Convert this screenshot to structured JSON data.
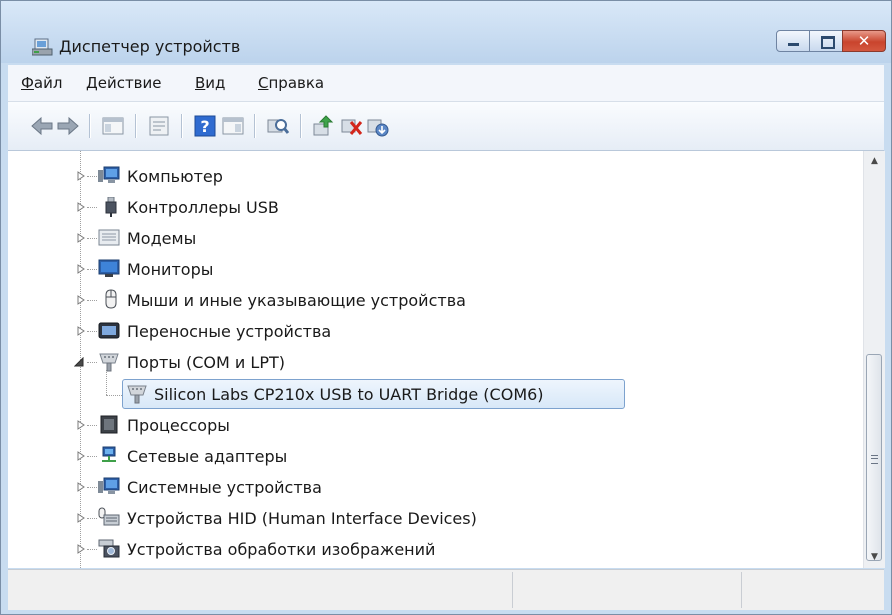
{
  "window": {
    "title": "Диспетчер устройств",
    "caption_buttons": {
      "minimize_icon": "minimize-icon",
      "maximize_icon": "maximize-icon",
      "close_icon": "close-icon",
      "close_glyph": "✕"
    }
  },
  "menu": {
    "items": [
      {
        "accel": "Ф",
        "rest": "айл"
      },
      {
        "accel": "Д",
        "rest": "ействие"
      },
      {
        "accel": "В",
        "rest": "ид"
      },
      {
        "accel": "С",
        "rest": "правка"
      }
    ]
  },
  "toolbar": {
    "icons": [
      "back-icon",
      "forward-icon",
      "show-hide-console-tree-icon",
      "properties-icon",
      "help-icon",
      "action-pane-icon",
      "scan-hardware-icon",
      "update-driver-icon",
      "uninstall-icon",
      "disable-device-icon"
    ]
  },
  "tree": {
    "nodes": [
      {
        "label": "Компьютер",
        "icon": "computer-icon",
        "expanded": false
      },
      {
        "label": "Контроллеры USB",
        "icon": "usb-plug-icon",
        "expanded": false
      },
      {
        "label": "Модемы",
        "icon": "modem-icon",
        "expanded": false
      },
      {
        "label": "Мониторы",
        "icon": "monitor-icon",
        "expanded": false
      },
      {
        "label": "Мыши и иные указывающие устройства",
        "icon": "mouse-icon",
        "expanded": false
      },
      {
        "label": "Переносные устройства",
        "icon": "portable-device-icon",
        "expanded": false
      },
      {
        "label": "Порты (COM и LPT)",
        "icon": "port-icon",
        "expanded": true
      },
      {
        "label": "Silicon Labs CP210x USB to UART Bridge (COM6)",
        "icon": "port-icon",
        "selected": true
      },
      {
        "label": "Процессоры",
        "icon": "processor-icon",
        "expanded": false
      },
      {
        "label": "Сетевые адаптеры",
        "icon": "network-adapter-icon",
        "expanded": false
      },
      {
        "label": "Системные устройства",
        "icon": "system-devices-icon",
        "expanded": false
      },
      {
        "label": "Устройства HID (Human Interface Devices)",
        "icon": "hid-icon",
        "expanded": false
      },
      {
        "label": "Устройства обработки изображений",
        "icon": "camera-icon",
        "expanded": false
      }
    ]
  },
  "scrollbar": {
    "up_glyph": "▲",
    "down_glyph": "▼"
  },
  "colors": {
    "title_bar": "#bcd3ec",
    "selection_border": "#7da2ce",
    "selection_fill": "#d8e8f8",
    "close_button": "#c9442d"
  }
}
